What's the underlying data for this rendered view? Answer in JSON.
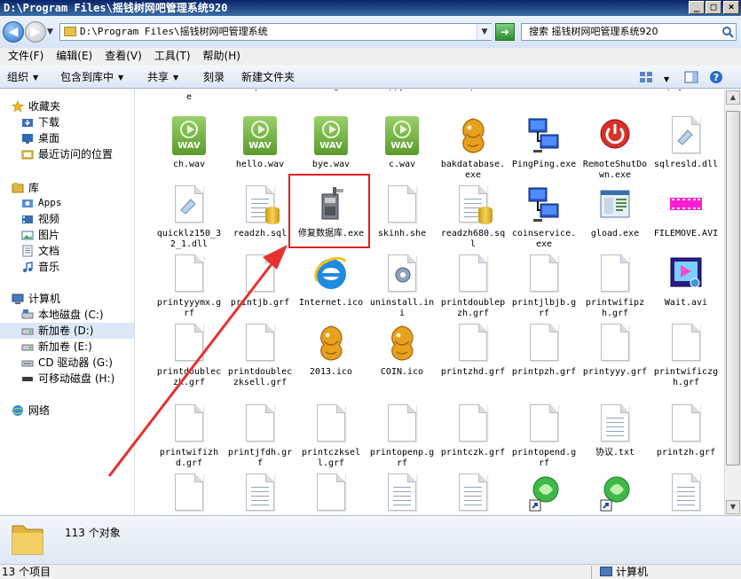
{
  "window": {
    "title": "D:\\Program Files\\摇钱树网吧管理系统920",
    "min": "_",
    "max": "□",
    "close": "×"
  },
  "address": {
    "path": "D:\\Program Files\\摇钱树网吧管理系统",
    "search_placeholder": "搜索 摇钱树网吧管理系统920"
  },
  "menu": [
    "文件(F)",
    "编辑(E)",
    "查看(V)",
    "工具(T)",
    "帮助(H)"
  ],
  "toolbar": {
    "organize": "组织",
    "include_library": "包含到库中",
    "share": "共享",
    "burn": "刻录",
    "new_folder": "新建文件夹"
  },
  "nav": {
    "favorites": "收藏夹",
    "downloads": "下载",
    "desktop": "桌面",
    "recent": "最近访问的位置",
    "libraries": "库",
    "apps": "Apps",
    "videos": "视频",
    "pictures": "图片",
    "documents": "文档",
    "music": "音乐",
    "computer": "计算机",
    "local_c": "本地磁盘 (C:)",
    "new_d": "新加卷 (D:)",
    "new_e": "新加卷 (E:)",
    "cd_g": "CD 驱动器 (G:)",
    "removable_h": "可移动磁盘 (H:)",
    "network": "网络"
  },
  "files": [
    {
      "name": "Checknost.exe",
      "type": "top"
    },
    {
      "name": "CVRApi.dll",
      "type": "top"
    },
    {
      "name": "fer.gif",
      "type": "top"
    },
    {
      "name": "happy.wav",
      "type": "top"
    },
    {
      "name": "setup.fil",
      "type": "top"
    },
    {
      "name": "account.wav",
      "type": "top"
    },
    {
      "name": "add.wav",
      "type": "top"
    },
    {
      "name": "pay.wav",
      "type": "top"
    },
    {
      "name": "ch.wav",
      "type": "wav"
    },
    {
      "name": "hello.wav",
      "type": "wav"
    },
    {
      "name": "bye.wav",
      "type": "wav"
    },
    {
      "name": "c.wav",
      "type": "wav"
    },
    {
      "name": "bakdatabase.exe",
      "type": "dragon"
    },
    {
      "name": "PingPing.exe",
      "type": "network"
    },
    {
      "name": "RemoteShutDown.exe",
      "type": "power"
    },
    {
      "name": "sqlresld.dll",
      "type": "dll"
    },
    {
      "name": "quicklz150_32_1.dll",
      "type": "dll"
    },
    {
      "name": "readzh.sql",
      "type": "sql"
    },
    {
      "name": "修复数据库.exe",
      "type": "repair"
    },
    {
      "name": "skinh.she",
      "type": "doc"
    },
    {
      "name": "readzh680.sql",
      "type": "sql"
    },
    {
      "name": "coinservice.exe",
      "type": "network"
    },
    {
      "name": "gload.exe",
      "type": "window"
    },
    {
      "name": "FILEMOVE.AVI",
      "type": "avi"
    },
    {
      "name": "printyyymx.grf",
      "type": "doc"
    },
    {
      "name": "printjb.grf",
      "type": "doc"
    },
    {
      "name": "Internet.ico",
      "type": "ie"
    },
    {
      "name": "uninstall.ini",
      "type": "ini"
    },
    {
      "name": "printdoublepzh.grf",
      "type": "doc"
    },
    {
      "name": "printjlbjb.grf",
      "type": "doc"
    },
    {
      "name": "printwifipzh.grf",
      "type": "doc"
    },
    {
      "name": "Wait.avi",
      "type": "media"
    },
    {
      "name": "printdoubleczk.grf",
      "type": "doc"
    },
    {
      "name": "printdoubleczksell.grf",
      "type": "doc"
    },
    {
      "name": "2013.ico",
      "type": "dragon"
    },
    {
      "name": "COIN.ico",
      "type": "dragon"
    },
    {
      "name": "printzhd.grf",
      "type": "doc"
    },
    {
      "name": "printpzh.grf",
      "type": "doc"
    },
    {
      "name": "printyyy.grf",
      "type": "doc"
    },
    {
      "name": "printwificzgh.grf",
      "type": "doc"
    },
    {
      "name": "printwifizhd.grf",
      "type": "doc"
    },
    {
      "name": "printjfdh.grf",
      "type": "doc"
    },
    {
      "name": "printczksell.grf",
      "type": "doc"
    },
    {
      "name": "printopenp.grf",
      "type": "doc"
    },
    {
      "name": "printczk.grf",
      "type": "doc"
    },
    {
      "name": "printopend.grf",
      "type": "doc"
    },
    {
      "name": "协议.txt",
      "type": "txt"
    },
    {
      "name": "printzh.grf",
      "type": "doc"
    },
    {
      "name": "",
      "type": "doc"
    },
    {
      "name": "",
      "type": "lines"
    },
    {
      "name": "",
      "type": "doc"
    },
    {
      "name": "",
      "type": "lines"
    },
    {
      "name": "",
      "type": "lines"
    },
    {
      "name": "",
      "type": "shortcut"
    },
    {
      "name": "",
      "type": "shortcut"
    },
    {
      "name": "",
      "type": "lines"
    }
  ],
  "details": {
    "count_text": "113 个对象"
  },
  "status": {
    "left": "13 个项目",
    "right": "计算机"
  },
  "colors": {
    "highlight": "#e02020",
    "titlebar": "#0a246a"
  }
}
